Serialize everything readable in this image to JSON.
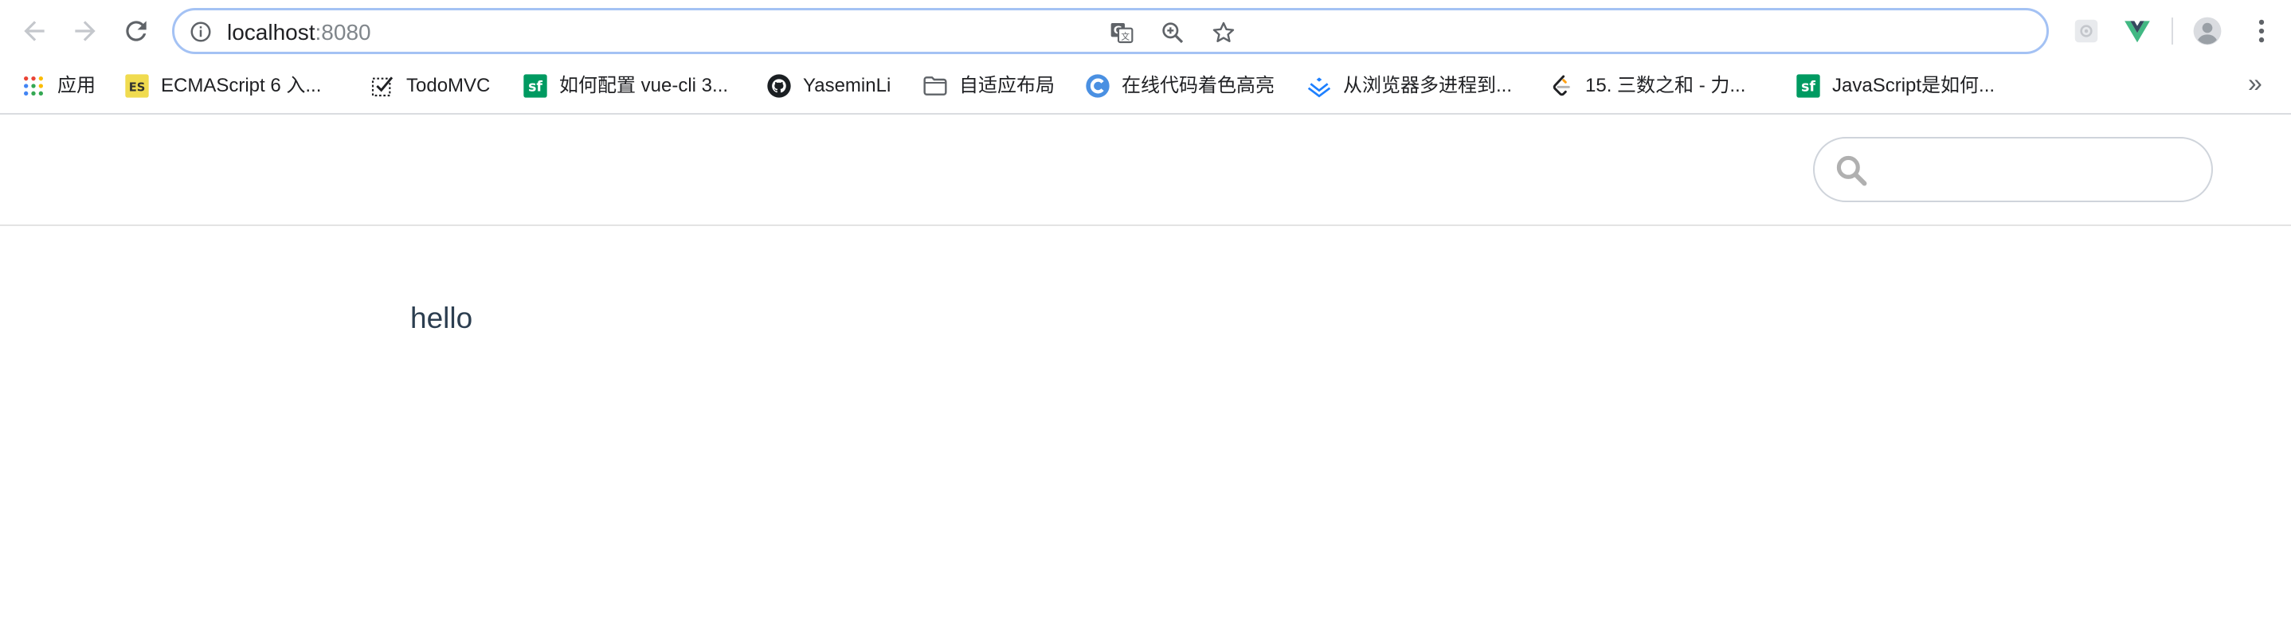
{
  "browser": {
    "url_host": "localhost",
    "url_port": ":8080",
    "toolbar_icons": [
      "back-arrow-icon",
      "forward-arrow-icon",
      "reload-icon",
      "info-icon",
      "translate-icon",
      "zoom-icon",
      "star-icon",
      "extension-icon",
      "vue-devtools-icon",
      "profile-icon",
      "menu-icon"
    ]
  },
  "bookmarks": [
    {
      "label": "应用",
      "icon": "apps-grid-icon"
    },
    {
      "label": "ECMAScript 6 入...",
      "icon": "es-icon"
    },
    {
      "label": "TodoMVC",
      "icon": "todomvc-icon"
    },
    {
      "label": "如何配置 vue-cli 3...",
      "icon": "sf-icon"
    },
    {
      "label": "YaseminLi",
      "icon": "github-icon"
    },
    {
      "label": "自适应布局",
      "icon": "folder-icon"
    },
    {
      "label": "在线代码着色高亮",
      "icon": "c-logo-icon"
    },
    {
      "label": "从浏览器多进程到...",
      "icon": "juejin-icon"
    },
    {
      "label": "15. 三数之和 - 力...",
      "icon": "leetcode-icon"
    },
    {
      "label": "JavaScript是如何...",
      "icon": "sf-icon"
    }
  ],
  "bookmarks_more": "»",
  "page": {
    "search_placeholder": "",
    "content": "hello"
  },
  "colors": {
    "omnibox_border": "#a4c2f4",
    "es_badge": "#f0db4f",
    "sf_badge": "#009a61",
    "vue_green": "#41b883",
    "page_text": "#2c3e50"
  }
}
